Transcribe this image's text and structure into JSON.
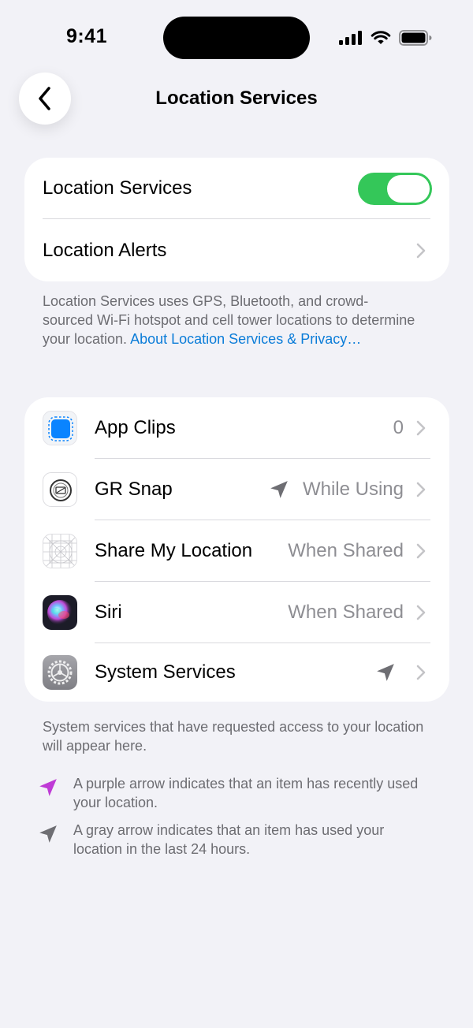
{
  "status_bar": {
    "time": "9:41",
    "icons": [
      "cellular-signal-icon",
      "wifi-icon",
      "battery-icon"
    ]
  },
  "nav": {
    "back_icon": "chevron-left-icon",
    "title": "Location Services"
  },
  "group1": {
    "location_services_label": "Location Services",
    "location_services_enabled": true,
    "location_alerts_label": "Location Alerts"
  },
  "description": {
    "text": "Location Services uses GPS, Bluetooth, and crowd-sourced Wi-Fi hotspot and cell tower locations to determine your location. ",
    "link": "About Location Services & Privacy…"
  },
  "apps": [
    {
      "name": "App Clips",
      "value": "0",
      "icon": "app-clips-icon",
      "arrow": ""
    },
    {
      "name": "GR Snap",
      "value": "While Using",
      "icon": "gr-snap-icon",
      "arrow": "gray"
    },
    {
      "name": "Share My Location",
      "value": "When Shared",
      "icon": "share-my-location-icon",
      "arrow": ""
    },
    {
      "name": "Siri",
      "value": "When Shared",
      "icon": "siri-icon",
      "arrow": ""
    },
    {
      "name": "System Services",
      "value": "",
      "icon": "system-services-gear-icon",
      "arrow": "gray"
    }
  ],
  "footer": {
    "system_note": "System services that have requested access to your location will appear here.",
    "purple_note": "A purple arrow indicates that an item has recently used your location.",
    "gray_note": "A gray arrow indicates that an item has used your location in the last 24 hours."
  },
  "colors": {
    "toggle_on": "#34c759",
    "link": "#0a7cd8",
    "purple_arrow": "#bf3bd6",
    "gray_arrow": "#6e6e73"
  }
}
